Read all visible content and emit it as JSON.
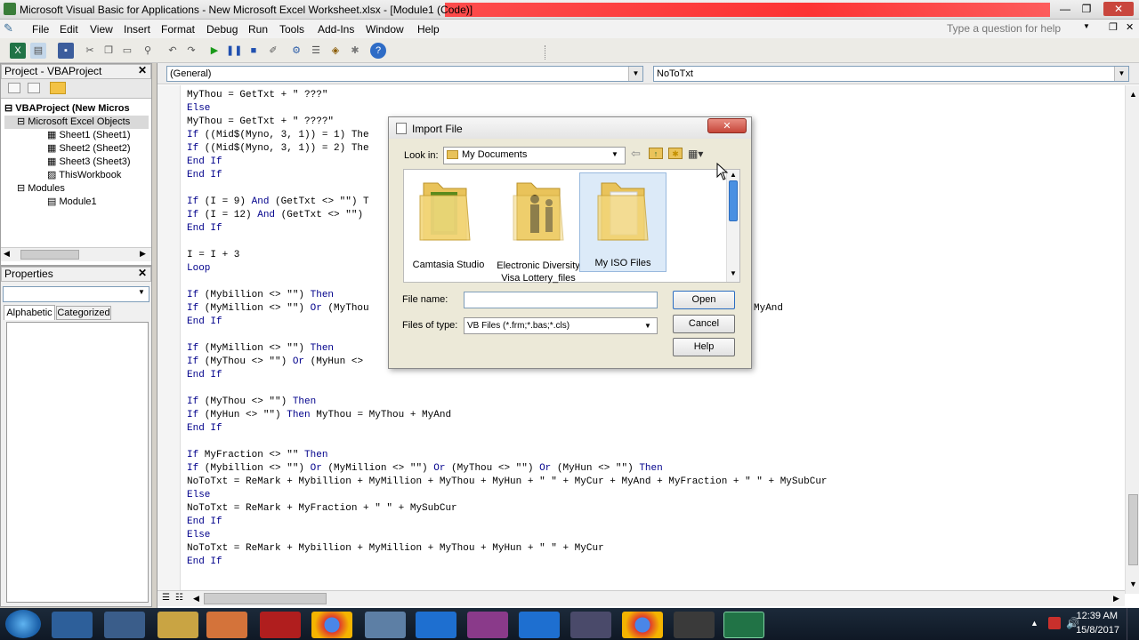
{
  "window": {
    "title": "Microsoft Visual Basic for Applications - New Microsoft Excel Worksheet.xlsx - [Module1 (Code)]",
    "help_placeholder": "Type a question for help"
  },
  "menu": [
    "File",
    "Edit",
    "View",
    "Insert",
    "Format",
    "Debug",
    "Run",
    "Tools",
    "Add-Ins",
    "Window",
    "Help"
  ],
  "project_panel": {
    "title": "Project - VBAProject",
    "tree": [
      {
        "label": "VBAProject (New Micros"
      },
      {
        "label": "Microsoft Excel Objects"
      },
      {
        "label": "Sheet1 (Sheet1)"
      },
      {
        "label": "Sheet2 (Sheet2)"
      },
      {
        "label": "Sheet3 (Sheet3)"
      },
      {
        "label": "ThisWorkbook"
      },
      {
        "label": "Modules"
      },
      {
        "label": "Module1"
      }
    ]
  },
  "properties_panel": {
    "title": "Properties",
    "tabs": [
      "Alphabetic",
      "Categorized"
    ]
  },
  "code_window": {
    "object_combo": "(General)",
    "proc_combo": "NoToTxt",
    "lines": [
      "MyThou = GetTxt + \" ???\"",
      "Else",
      "MyThou = GetTxt + \" ????\"",
      "If ((Mid$(Myno, 3, 1)) = 1) The",
      "If ((Mid$(Myno, 3, 1)) = 2) The",
      "End If",
      "End If",
      "",
      "If (I = 9) And (GetTxt <> \"\") T",
      "If (I = 12) And (GetTxt <> \"\")",
      "End If",
      "",
      "I = I + 3",
      "Loop",
      "",
      "If (Mybillion <> \"\") Then",
      "If (MyMillion <> \"\") Or (MyThou",
      "End If",
      "",
      "If (MyMillion <> \"\") Then",
      "If (MyThou <> \"\") Or (MyHun <>",
      "End If",
      "",
      "If (MyThou <> \"\") Then",
      "If (MyHun <> \"\") Then MyThou = MyThou + MyAnd",
      "End If",
      "",
      "If MyFraction <> \"\" Then",
      "If (Mybillion <> \"\") Or (MyMillion <> \"\") Or (MyThou <> \"\") Or (MyHun <> \"\") Then",
      "NoToTxt = ReMark + Mybillion + MyMillion + MyThou + MyHun + \" \" + MyCur + MyAnd + MyFraction + \" \" + MySubCur",
      "Else",
      "NoToTxt = ReMark + MyFraction + \" \" + MySubCur",
      "End If",
      "Else",
      "NoToTxt = ReMark + Mybillion + MyMillion + MyThou + MyHun + \" \" + MyCur",
      "End If"
    ],
    "trailing_fragment": "MyAnd"
  },
  "dialog": {
    "title": "Import File",
    "look_in_label": "Look in:",
    "look_in_value": "My Documents",
    "folders": [
      {
        "name": "Camtasia Studio",
        "icon": "camtasia-folder-icon"
      },
      {
        "name": "Electronic Diversity Visa Lottery_files",
        "icon": "people-folder-icon"
      },
      {
        "name": "My ISO Files",
        "icon": "folder-icon"
      }
    ],
    "file_name_label": "File name:",
    "file_name_value": "",
    "files_of_type_label": "Files of type:",
    "files_of_type_value": "VB Files (*.frm;*.bas;*.cls)",
    "open_label": "Open",
    "cancel_label": "Cancel",
    "help_label": "Help"
  },
  "taskbar": {
    "time": "12:39 AM",
    "date": "15/8/2017"
  },
  "colors": {
    "keyword": "#00008b",
    "title_red": "#ff2020",
    "dialog_bg": "#ece9d8"
  }
}
